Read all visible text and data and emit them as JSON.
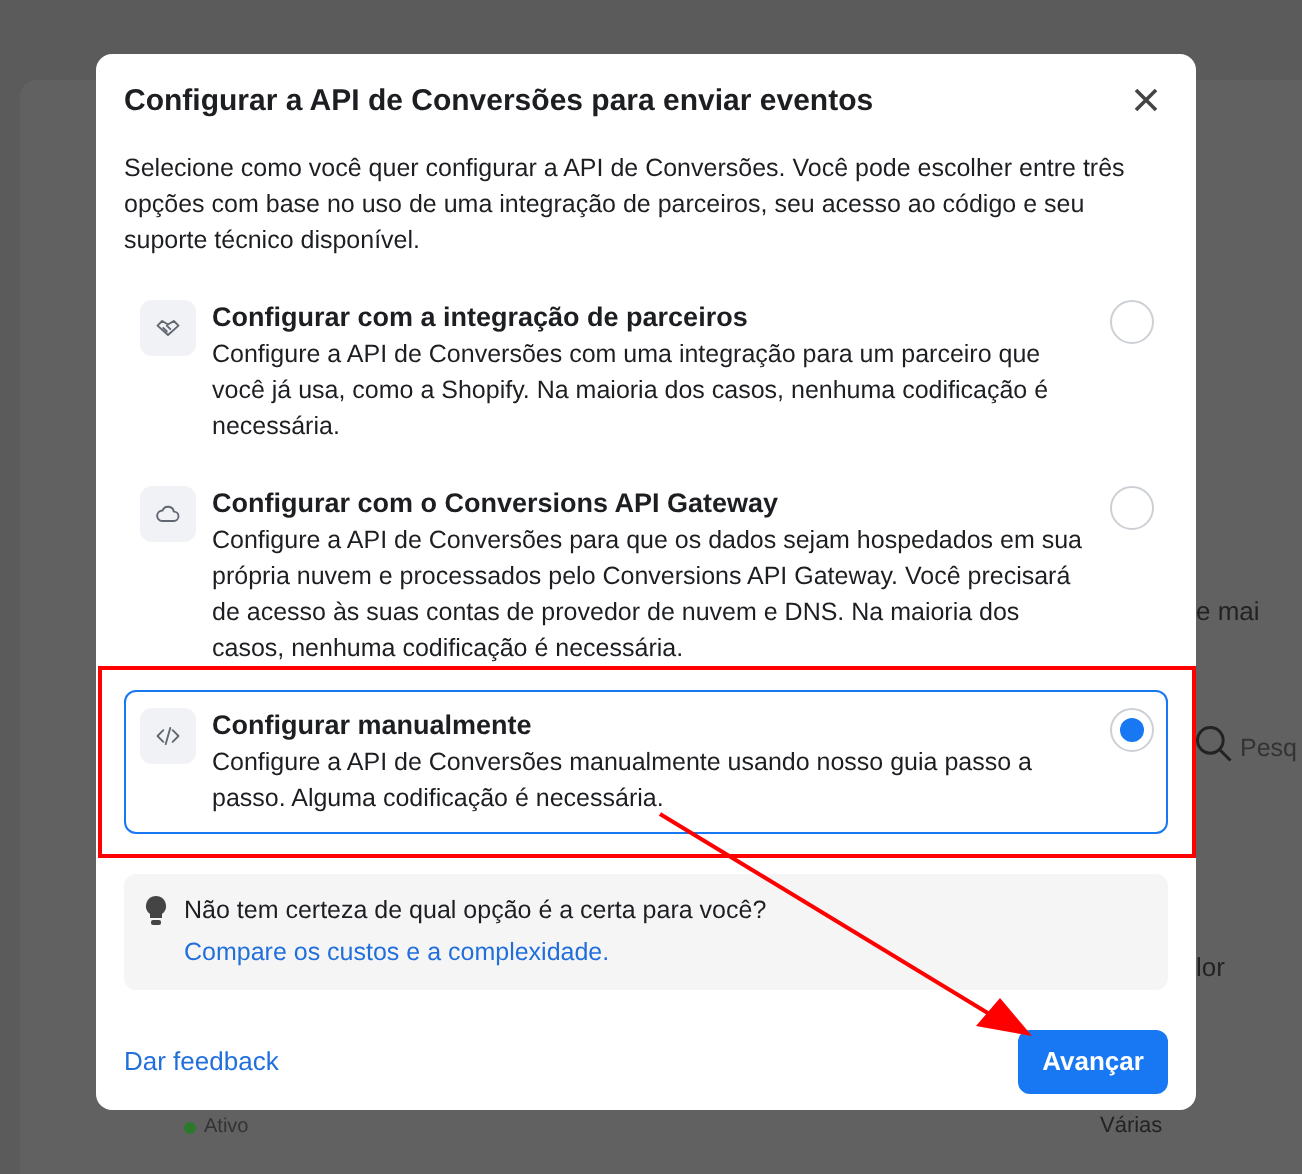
{
  "background": {
    "chart_label": "e mai",
    "search_placeholder": "Pesq",
    "column_text": "lor",
    "row_value": "Várias",
    "row_status": "Ativo"
  },
  "dialog": {
    "title": "Configurar a API de Conversões para enviar eventos",
    "description": "Selecione como você quer configurar a API de Conversões. Você pode escolher entre três opções com base no uso de uma integração de parceiros, seu acesso ao código e seu suporte técnico disponível.",
    "options": [
      {
        "kind": "partner",
        "title": "Configurar com a integração de parceiros",
        "description": "Configure a API de Conversões com uma integração para um parceiro que você já usa, como a Shopify. Na maioria dos casos, nenhuma codificação é necessária.",
        "selected": false
      },
      {
        "kind": "cloud",
        "title": "Configurar com o Conversions API Gateway",
        "description": "Configure a API de Conversões para que os dados sejam hospedados em sua própria nuvem e processados pelo Conversions API Gateway. Você precisará de acesso às suas contas de provedor de nuvem e DNS. Na maioria dos casos, nenhuma codificação é necessária.",
        "selected": false
      },
      {
        "kind": "code",
        "title": "Configurar manualmente",
        "description": "Configure a API de Conversões manualmente usando nosso guia passo a passo. Alguma codificação é necessária.",
        "selected": true
      }
    ],
    "tip": {
      "text": "Não tem certeza de qual opção é a certa para você?",
      "link": "Compare os custos e a complexidade."
    },
    "feedback_link": "Dar feedback",
    "next_button": "Avançar"
  }
}
